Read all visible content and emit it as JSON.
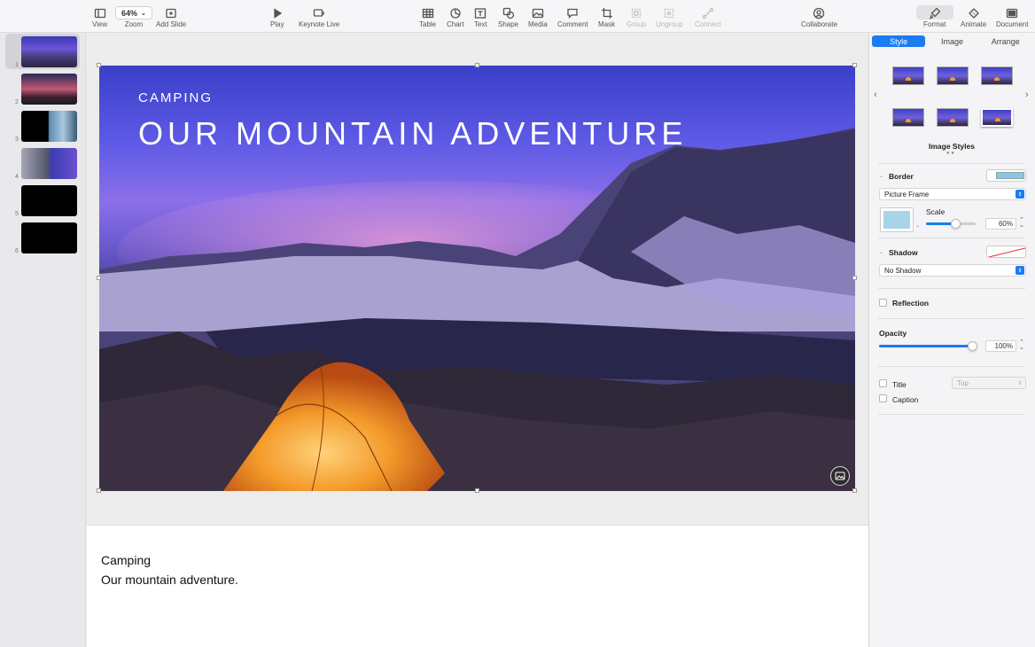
{
  "toolbar": {
    "view": "View",
    "zoom_value": "64%",
    "zoom": "Zoom",
    "add_slide": "Add Slide",
    "play": "Play",
    "keynote_live": "Keynote Live",
    "table": "Table",
    "chart": "Chart",
    "text": "Text",
    "shape": "Shape",
    "media": "Media",
    "comment": "Comment",
    "mask": "Mask",
    "group": "Group",
    "ungroup": "Ungroup",
    "connect": "Connect",
    "collaborate": "Collaborate",
    "format": "Format",
    "animate": "Animate",
    "document": "Document"
  },
  "navigator": {
    "slides": [
      "1",
      "2",
      "3",
      "4",
      "5",
      "6"
    ]
  },
  "slide": {
    "subtitle": "CAMPING",
    "title": "OUR MOUNTAIN ADVENTURE"
  },
  "notes": {
    "line1": "Camping",
    "line2": "Our mountain adventure."
  },
  "inspector": {
    "tabs": {
      "style": "Style",
      "image": "Image",
      "arrange": "Arrange"
    },
    "image_styles": "Image Styles",
    "border": "Border",
    "border_type": "Picture Frame",
    "scale_label": "Scale",
    "scale_value": "60%",
    "scale_fraction": 0.6,
    "shadow": "Shadow",
    "shadow_type": "No Shadow",
    "reflection": "Reflection",
    "opacity": "Opacity",
    "opacity_value": "100%",
    "opacity_fraction": 1.0,
    "title": "Title",
    "title_position": "Top",
    "caption": "Caption"
  },
  "colors": {
    "accent": "#1a7cf0",
    "tent": "#f39a2a"
  }
}
